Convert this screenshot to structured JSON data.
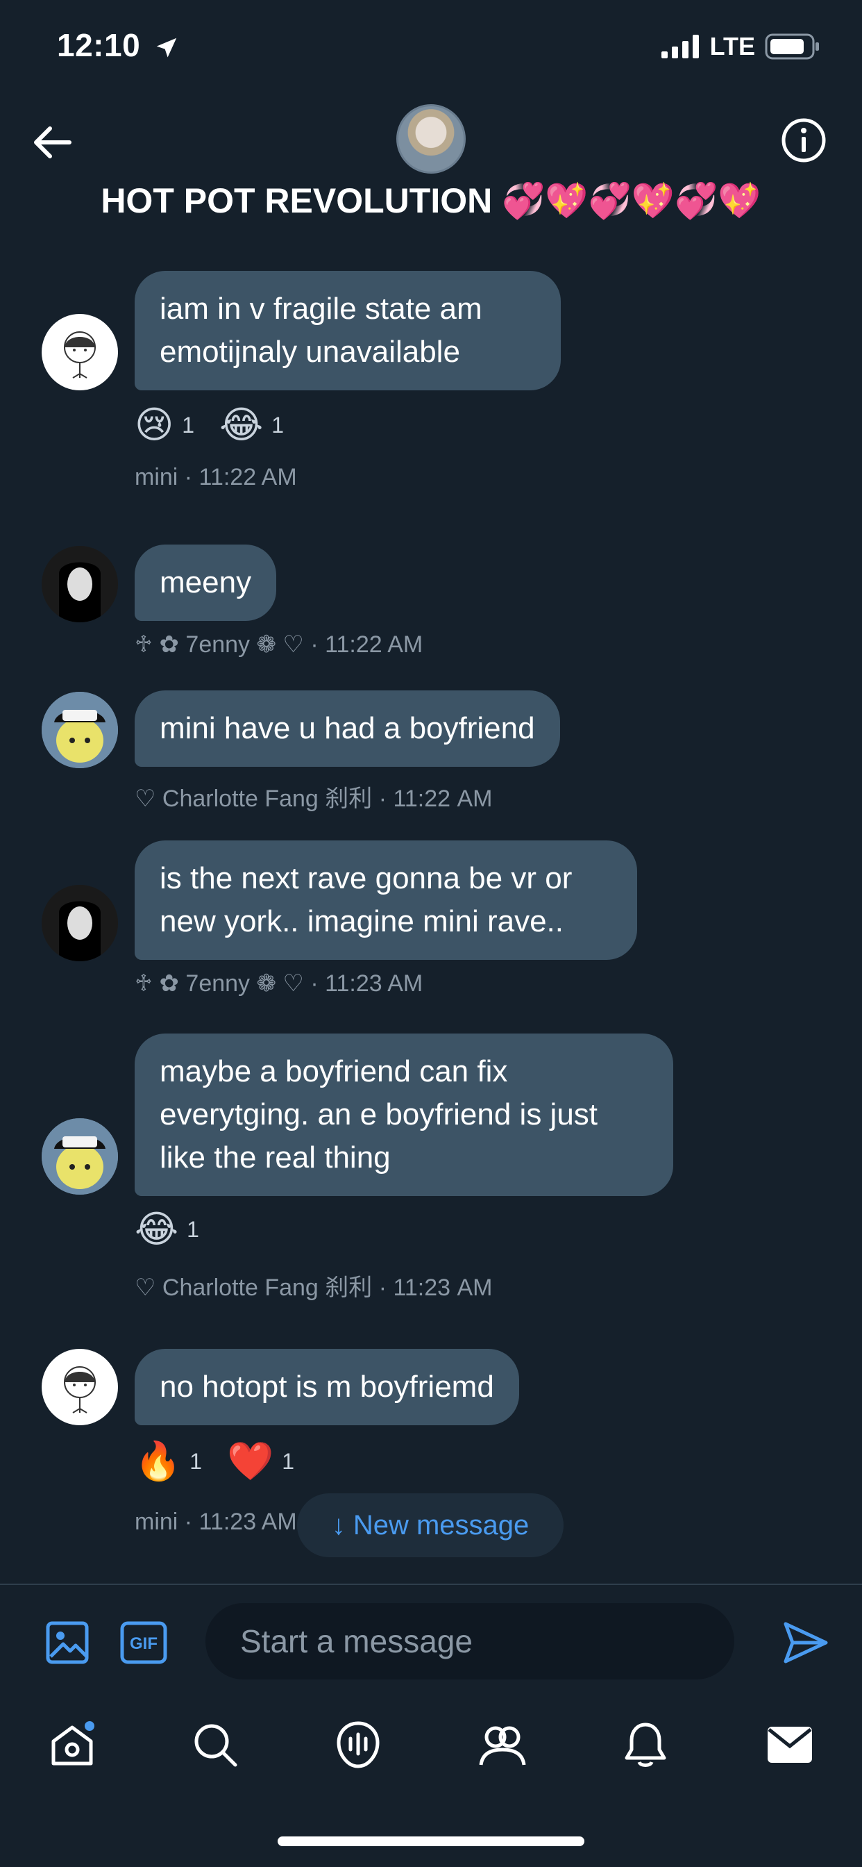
{
  "status_bar": {
    "time": "12:10",
    "network": "LTE"
  },
  "header": {
    "title": "HOT POT REVOLUTION",
    "title_emoji": "💞💖💞💖💞💖"
  },
  "messages": [
    {
      "author": "mini",
      "text": "iam in v fragile state  am emotijnaly unavailable",
      "reactions": [
        {
          "emoji": "😢",
          "count": "1"
        },
        {
          "emoji": "😂",
          "count": "1"
        }
      ],
      "meta": "mini · 11:22 AM"
    },
    {
      "author": "7enny",
      "text": "meeny",
      "meta": "♱ ✿ 7enny ❁ ♡ · 11:22 AM"
    },
    {
      "author": "Charlotte Fang",
      "text": "mini have u had a boyfriend",
      "meta": "♡ Charlotte Fang 刹利 · 11:22 AM"
    },
    {
      "author": "7enny",
      "text": "is the next rave gonna be vr or new york.. imagine mini rave..",
      "meta": "♱ ✿ 7enny ❁ ♡ · 11:23 AM"
    },
    {
      "author": "Charlotte Fang",
      "text": "maybe a boyfriend can fix everytging. an e boyfriend is just like the real thing",
      "reactions": [
        {
          "emoji": "😂",
          "count": "1"
        }
      ],
      "meta": "♡ Charlotte Fang 刹利 · 11:23 AM"
    },
    {
      "author": "mini",
      "text": "no hotopt is m boyfriemd",
      "reactions": [
        {
          "emoji": "🔥",
          "count": "1"
        },
        {
          "emoji": "❤️",
          "count": "1"
        }
      ],
      "meta": "mini · 11:23 AM"
    }
  ],
  "new_message_label": "↓ New message",
  "composer": {
    "placeholder": "Start a message",
    "gif_label": "GIF"
  },
  "colors": {
    "background": "#15202b",
    "bubble": "#3d5466",
    "accent": "#4a9bf0",
    "meta": "#8b98a5"
  },
  "tabs": [
    "home-icon",
    "search-icon",
    "spaces-icon",
    "communities-icon",
    "notifications-icon",
    "messages-icon"
  ]
}
